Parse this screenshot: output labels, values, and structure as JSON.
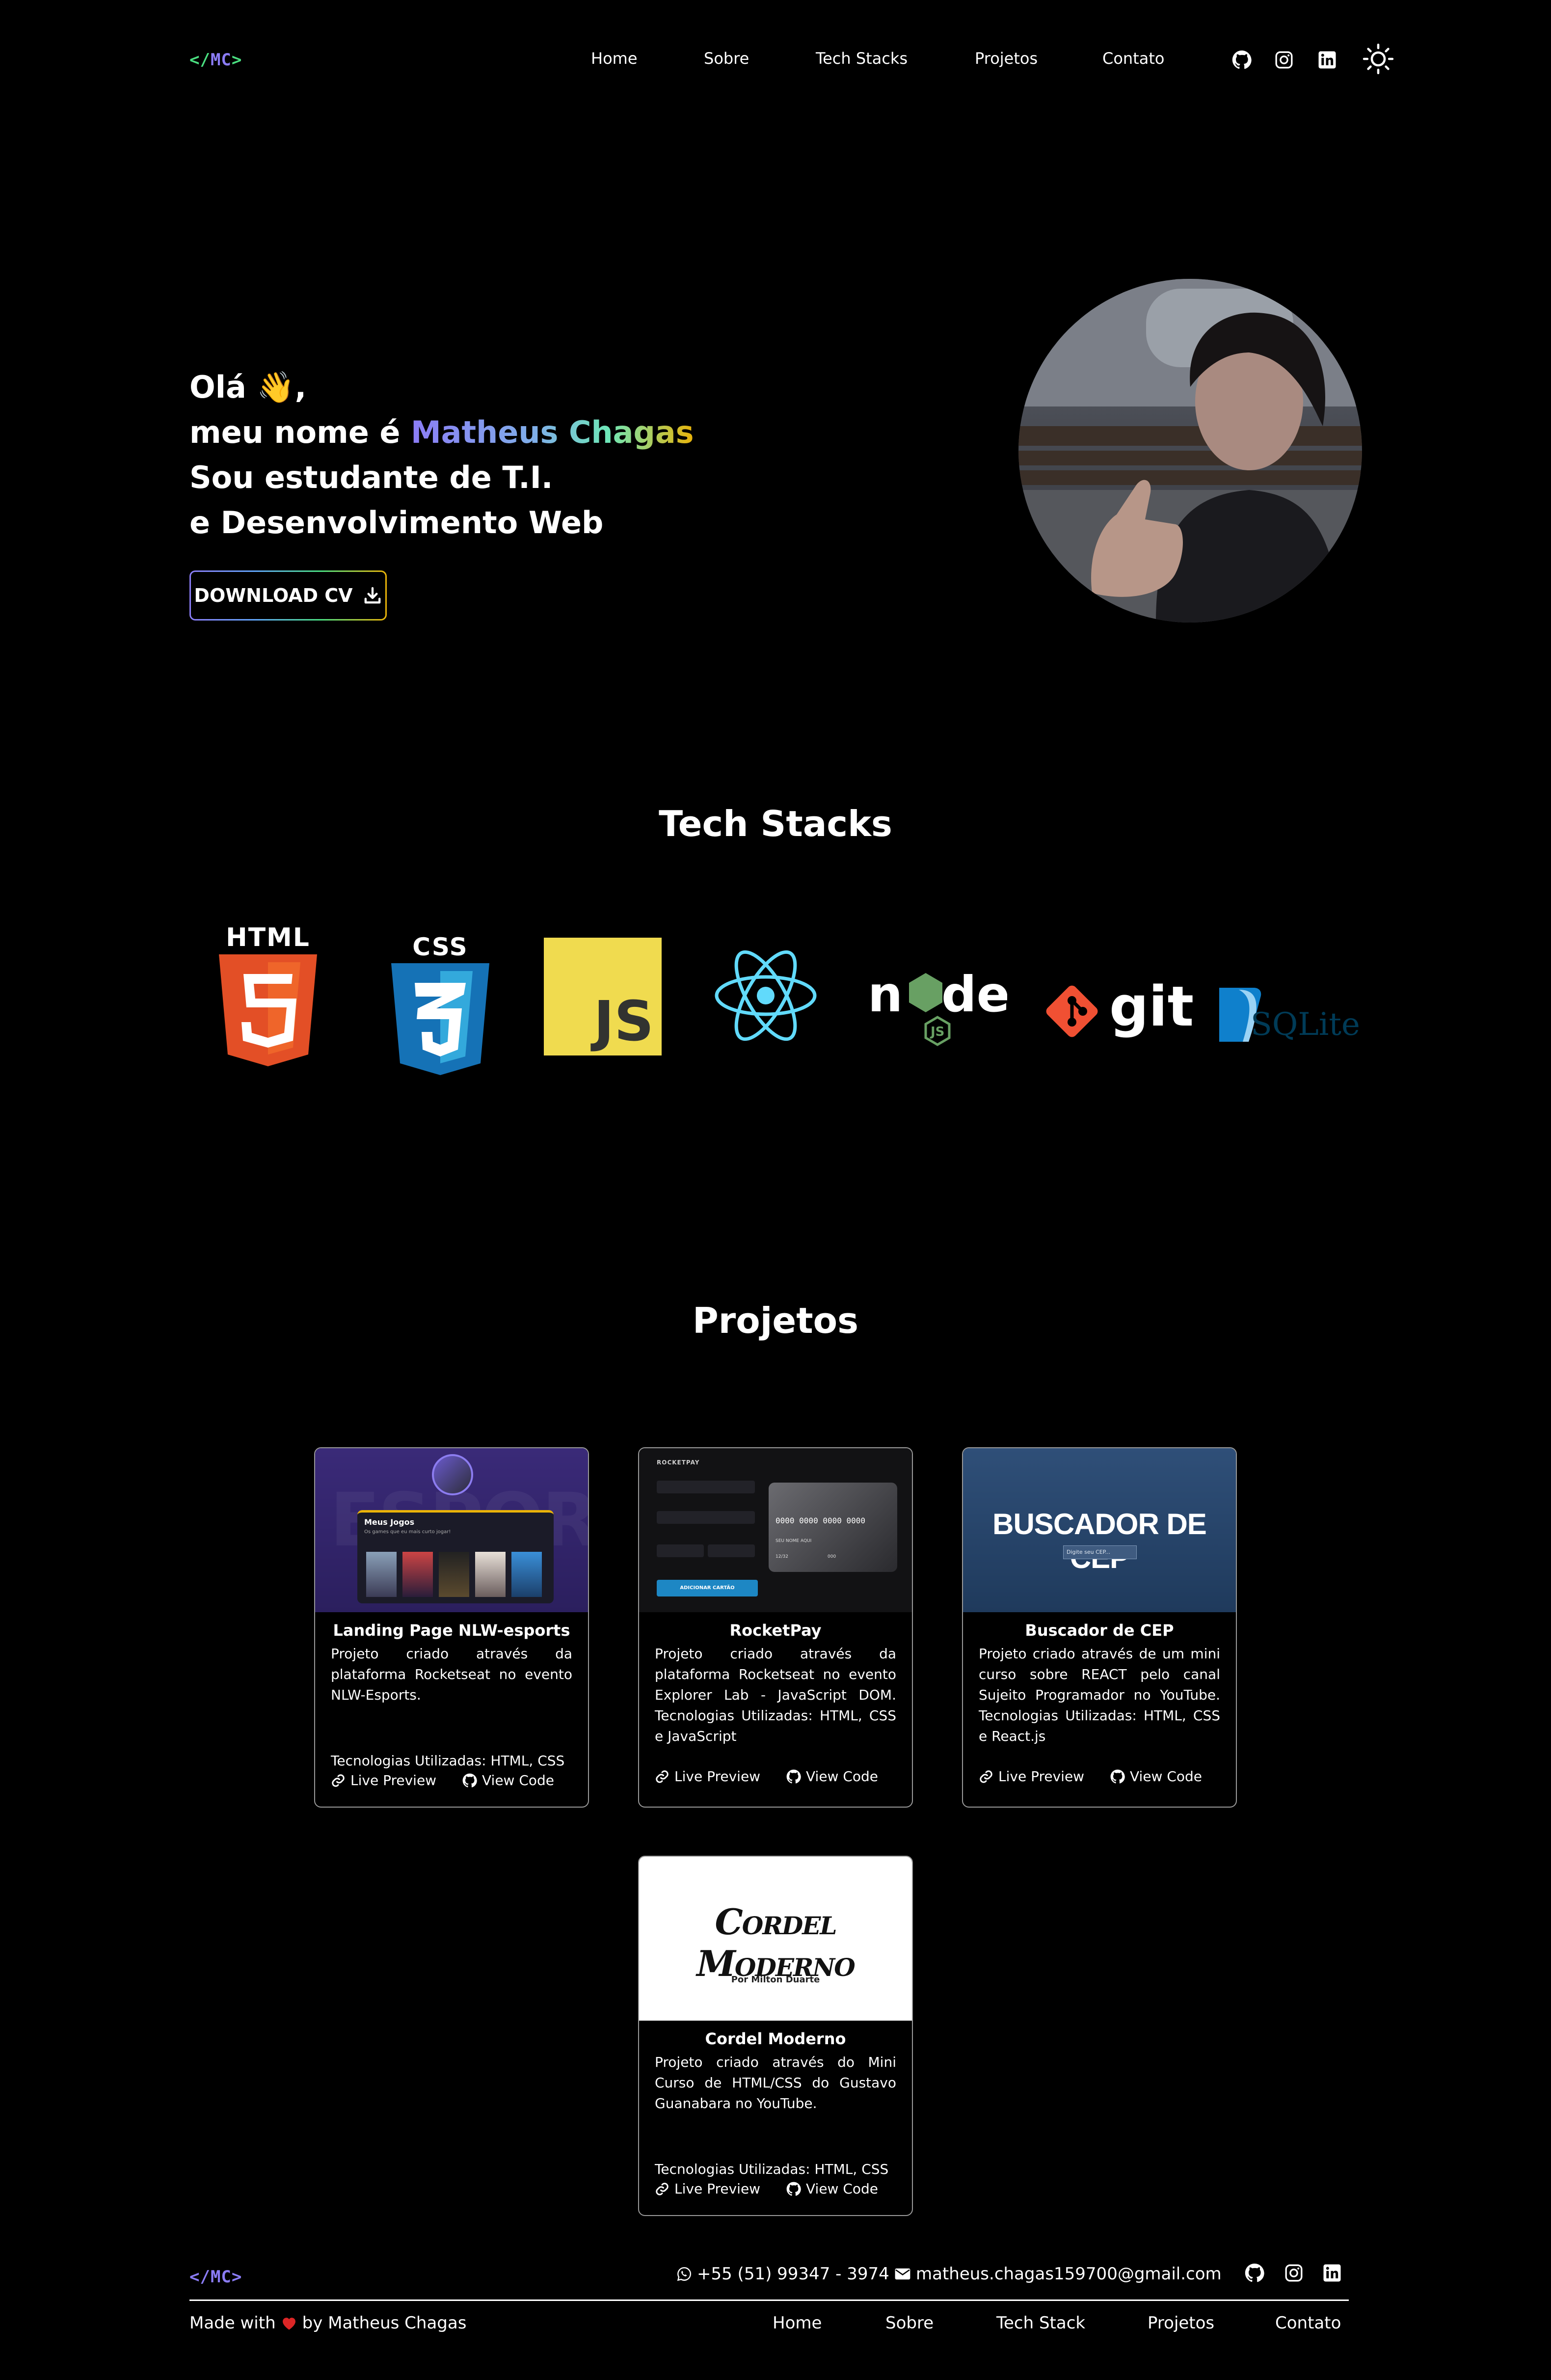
{
  "header": {
    "logo": {
      "open": "</",
      "text": "MC",
      "close": ">"
    },
    "nav": [
      "Home",
      "Sobre",
      "Tech Stacks",
      "Projetos",
      "Contato"
    ]
  },
  "hero": {
    "greeting": "Olá 👋,",
    "name_prefix": "meu nome é ",
    "name": "Matheus Chagas",
    "line3": "Sou estudante de T.I.",
    "line4": "e Desenvolvimento Web",
    "cv_button": "DOWNLOAD CV"
  },
  "tech": {
    "title": "Tech Stacks",
    "html_label": "HTML",
    "css_label": "CSS",
    "js_label": "JS",
    "git_label": "git",
    "sqlite_label": "SQLite"
  },
  "projects": {
    "title": "Projetos",
    "live_label": "Live Preview",
    "code_label": "View Code",
    "cards": [
      {
        "title": "Landing Page NLW-esports",
        "description": "Projeto criado através da plataforma Rocketseat no evento NLW-Esports.",
        "tech": "Tecnologias Utilizadas: HTML, CSS",
        "thumb_heading": "Meus Jogos",
        "thumb_sub": "Os games que eu mais curto jogar!"
      },
      {
        "title": "RocketPay",
        "description": "Projeto criado através da plataforma Rocketseat no evento Explorer Lab - JavaScript DOM. Tecnologias Utilizadas: HTML, CSS e JavaScript",
        "thumb_brand": "ROCKETPAY",
        "thumb_card_number": "0000 0000 0000 0000",
        "thumb_name": "SEU NOME AQUI",
        "thumb_exp": "12/32",
        "thumb_cvc": "000",
        "thumb_button": "ADICIONAR CARTÃO"
      },
      {
        "title": "Buscador de CEP",
        "description": "Projeto criado através de um mini curso sobre REACT pelo canal Sujeito Programador no YouTube. Tecnologias Utilizadas: HTML, CSS e React.js",
        "thumb_heading": "BUSCADOR DE CEP",
        "thumb_input": "Digite seu CEP..."
      },
      {
        "title": "Cordel Moderno",
        "description": "Projeto criado através do Mini Curso de HTML/CSS do Gustavo Guanabara no YouTube.",
        "tech": "Tecnologias Utilizadas: HTML, CSS",
        "thumb_heading": "Cordel Moderno",
        "thumb_sub": "Por Milton Duarte"
      }
    ]
  },
  "footer": {
    "logo": {
      "open": "</",
      "text": "MC",
      "close": ">"
    },
    "phone": "+55 (51) 99347 - 3974",
    "email": "matheus.chagas159700@gmail.com",
    "made_with": "Made with",
    "by": "by Matheus Chagas",
    "nav": [
      "Home",
      "Sobre",
      "Tech Stack",
      "Projetos",
      "Contato"
    ]
  },
  "colors": {
    "accent_purple": "#8b7cf6",
    "accent_green": "#4ade80",
    "accent_yellow": "#eab308",
    "heart": "#dc2626"
  }
}
